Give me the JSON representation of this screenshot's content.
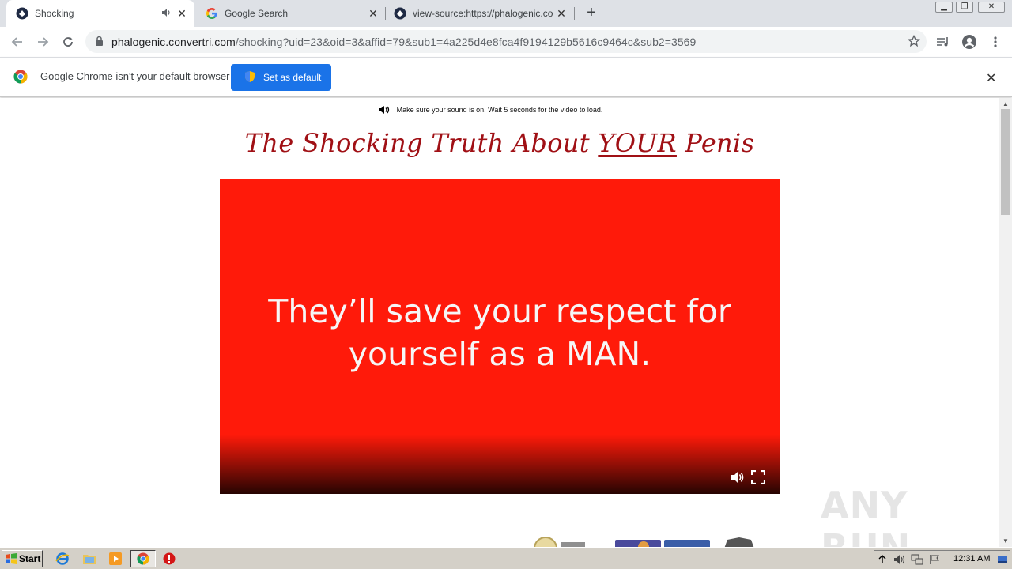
{
  "tabs": [
    {
      "title": "Shocking",
      "favicon": "phalogenic-icon",
      "audio": true,
      "active": true
    },
    {
      "title": "Google Search",
      "favicon": "google-g-icon",
      "active": false
    },
    {
      "title": "view-source:https://phalogenic.conv",
      "favicon": "phalogenic-icon",
      "active": false
    }
  ],
  "address_bar": {
    "domain": "phalogenic.convertri.com",
    "path": "/shocking?uid=23&oid=3&affid=79&sub1=4a225d4e8fca4f9194129b5616c9464c&sub2=3569"
  },
  "infobar": {
    "message": "Google Chrome isn't your default browser",
    "button_label": "Set as default"
  },
  "page": {
    "notice": "Make sure your sound is on. Wait 5 seconds for the video to load.",
    "headline_before": "The Shocking Truth About ",
    "headline_emph": "YOUR",
    "headline_after": " Penis",
    "video_caption_line1": "They’ll save your respect for",
    "video_caption_line2": "yourself as a MAN."
  },
  "watermark": "ANY RUN",
  "taskbar": {
    "start_label": "Start",
    "clock": "12:31 AM"
  },
  "colors": {
    "headline": "#a01015",
    "video_bg": "#ff1a0a",
    "accent_button": "#1a73e8"
  }
}
